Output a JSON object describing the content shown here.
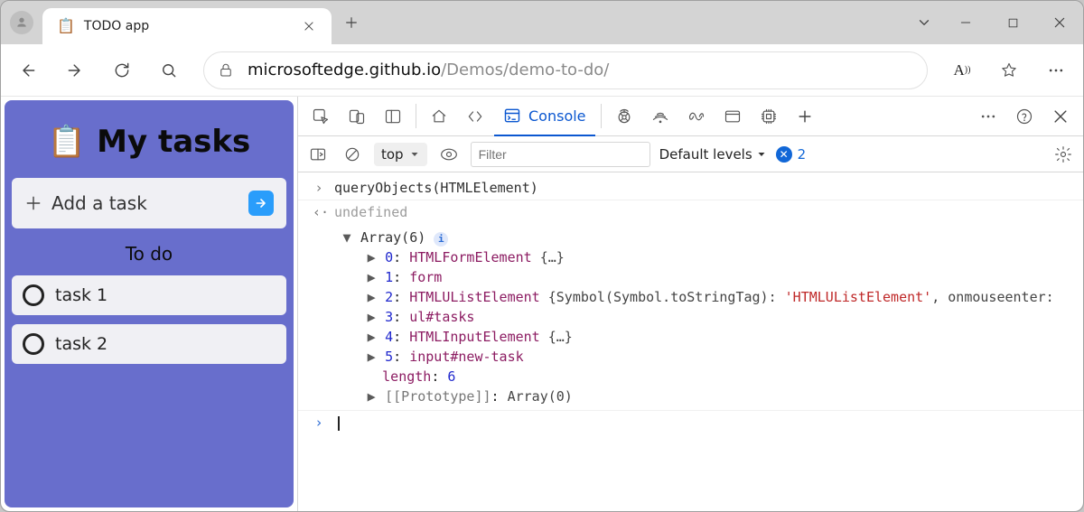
{
  "browser": {
    "tab_title": "TODO app",
    "url_host": "microsoftedge.github.io",
    "url_path": "/Demos/demo-to-do/"
  },
  "page": {
    "heading": "My tasks",
    "add_placeholder": "Add a task",
    "section_todo": "To do",
    "tasks": [
      "task 1",
      "task 2"
    ]
  },
  "devtools": {
    "tabs": {
      "console": "Console"
    },
    "toolbar": {
      "context": "top",
      "filter_placeholder": "Filter",
      "levels": "Default levels",
      "issues_count": "2"
    },
    "console": {
      "input": "queryObjects(HTMLElement)",
      "return": "undefined",
      "array_header": "Array(6)",
      "items": [
        {
          "i": "0",
          "type": "HTMLFormElement",
          "rest": " {…}"
        },
        {
          "i": "1",
          "type": "form",
          "rest": ""
        },
        {
          "i": "2",
          "type": "HTMLUListElement",
          "rest": " {Symbol(Symbol.toStringTag): ",
          "str": "'HTMLUListElement'",
          "rest2": ", onmouseenter:"
        },
        {
          "i": "3",
          "type": "ul#tasks",
          "rest": ""
        },
        {
          "i": "4",
          "type": "HTMLInputElement",
          "rest": " {…}"
        },
        {
          "i": "5",
          "type": "input#new-task",
          "rest": ""
        }
      ],
      "length_label": "length",
      "length_val": "6",
      "proto_label": "[[Prototype]]",
      "proto_val": "Array(0)"
    }
  }
}
